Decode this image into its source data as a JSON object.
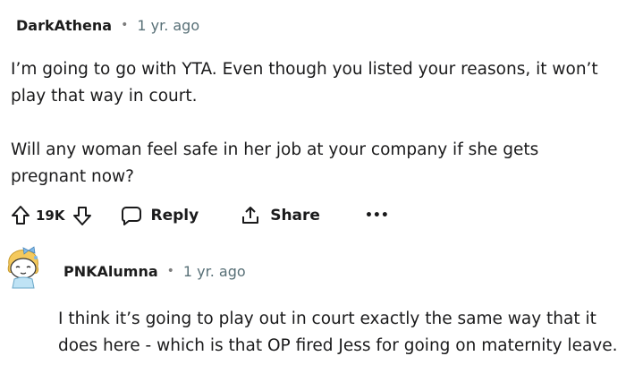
{
  "comment": {
    "author": "DarkAthena",
    "separator": "•",
    "time": "1 yr. ago",
    "paragraphs": [
      "I’m going to go with YTA. Even though you listed your reasons, it won’t play that way in court.",
      "Will any woman feel safe in her job at your company if she gets pregnant now?"
    ],
    "actions": {
      "vote_count": "19K",
      "reply_label": "Reply",
      "share_label": "Share",
      "more_label": "•••"
    }
  },
  "reply": {
    "author": "PNKAlumna",
    "separator": "•",
    "time": "1 yr. ago",
    "text": "I think it’s going to play out in court exactly the same way that it does here - which is that OP fired Jess for going on maternity leave."
  },
  "icons": {
    "upvote": "upvote-arrow-icon",
    "downvote": "downvote-arrow-icon",
    "reply": "speech-bubble-icon",
    "share": "share-icon",
    "more": "more-dots-icon",
    "avatar": "snoo-avatar-icon"
  },
  "colors": {
    "text": "#1a1a1b",
    "meta": "#576f76",
    "avatar_hair": "#f4c95d",
    "avatar_bow": "#7fb8e8"
  }
}
